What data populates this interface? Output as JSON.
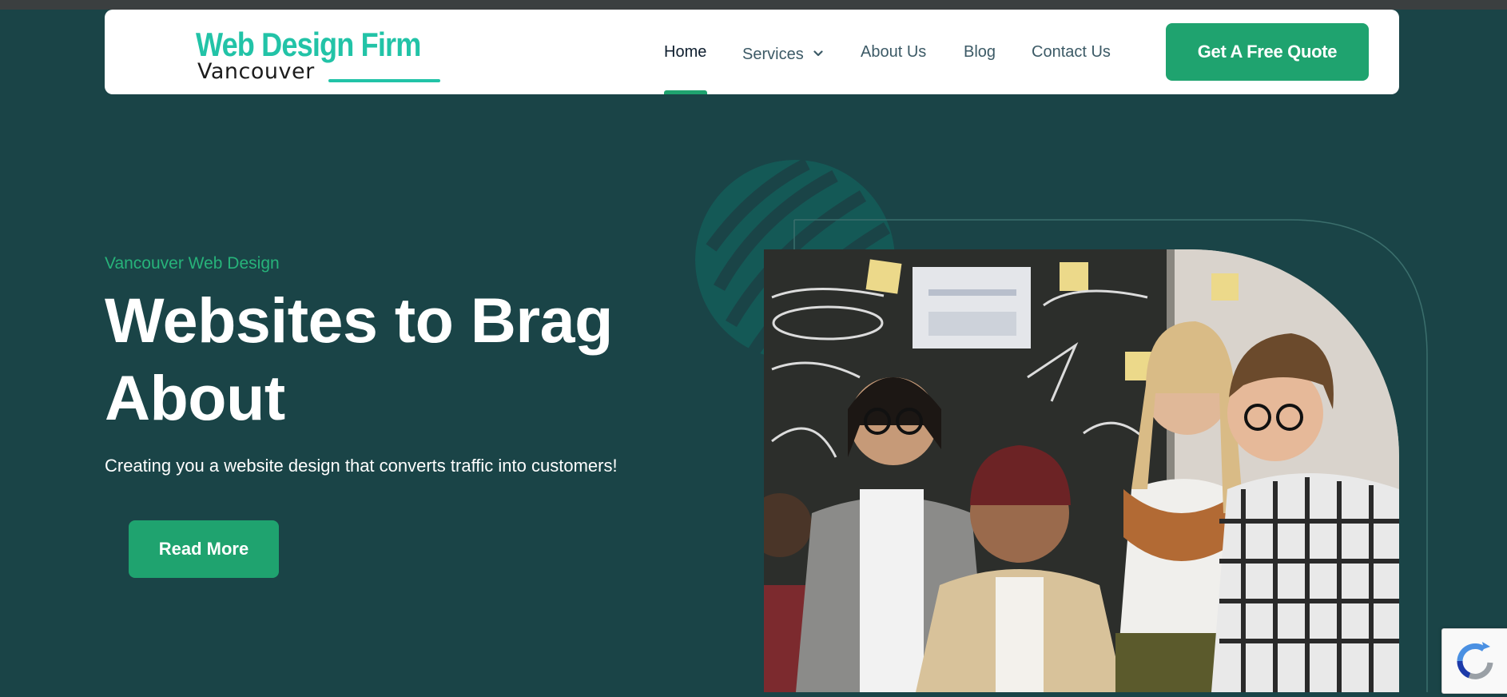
{
  "header": {
    "logo": {
      "line1": "Web Design Firm",
      "line2": "Vancouver"
    },
    "nav": [
      {
        "label": "Home",
        "active": true
      },
      {
        "label": "Services",
        "has_dropdown": true
      },
      {
        "label": "About Us"
      },
      {
        "label": "Blog"
      },
      {
        "label": "Contact Us"
      }
    ],
    "cta_label": "Get A Free Quote"
  },
  "hero": {
    "eyebrow": "Vancouver Web Design",
    "headline_line1": "Websites to Brag",
    "headline_line2": "About",
    "subheading": "Creating you a website design that converts traffic into customers!",
    "button_label": "Read More",
    "image": "team-at-chalkboard-photo"
  },
  "widgets": {
    "recaptcha_icon": "recaptcha-icon"
  },
  "colors": {
    "background": "#1a4447",
    "accent": "#1fa36f",
    "logo": "#22c3a7",
    "eyebrow": "#27b37a",
    "header": "#ffffff"
  }
}
